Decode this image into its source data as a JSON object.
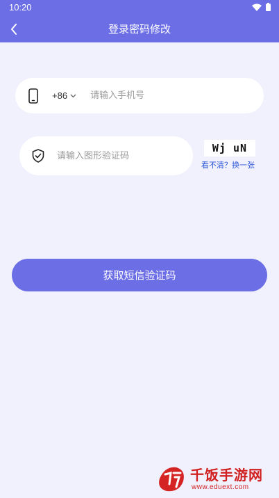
{
  "status_bar": {
    "time": "10:20"
  },
  "header": {
    "title": "登录密码修改"
  },
  "phone": {
    "country_code": "+86",
    "placeholder": "请输入手机号",
    "value": ""
  },
  "captcha": {
    "placeholder": "请输入图形验证码",
    "value": "",
    "image_text": "Wj uN",
    "refresh_label": "看不清？换一张"
  },
  "submit": {
    "label": "获取短信验证码"
  },
  "watermark": {
    "name": "千饭手游网",
    "url": "www.eduext.com"
  },
  "colors": {
    "accent": "#6c6ee6",
    "background": "#f1f0fd",
    "link": "#2a56d6"
  },
  "icons": [
    "back-arrow-icon",
    "wifi-icon",
    "battery-icon",
    "phone-icon",
    "chevron-down-icon",
    "shield-check-icon"
  ]
}
